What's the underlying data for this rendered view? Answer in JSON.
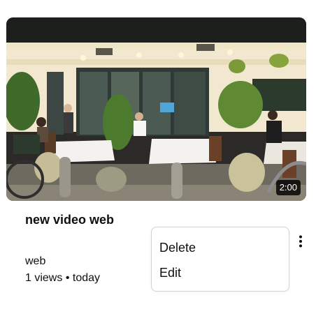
{
  "video": {
    "duration": "2:00",
    "title": "new video web",
    "channel": "web",
    "views": "1 views",
    "separator": "•",
    "age": "today",
    "meta_line": "1 views • today"
  },
  "context_menu": {
    "items": [
      {
        "label": "Delete"
      },
      {
        "label": "Edit"
      }
    ]
  },
  "icons": {
    "more": "more-vertical-icon"
  }
}
